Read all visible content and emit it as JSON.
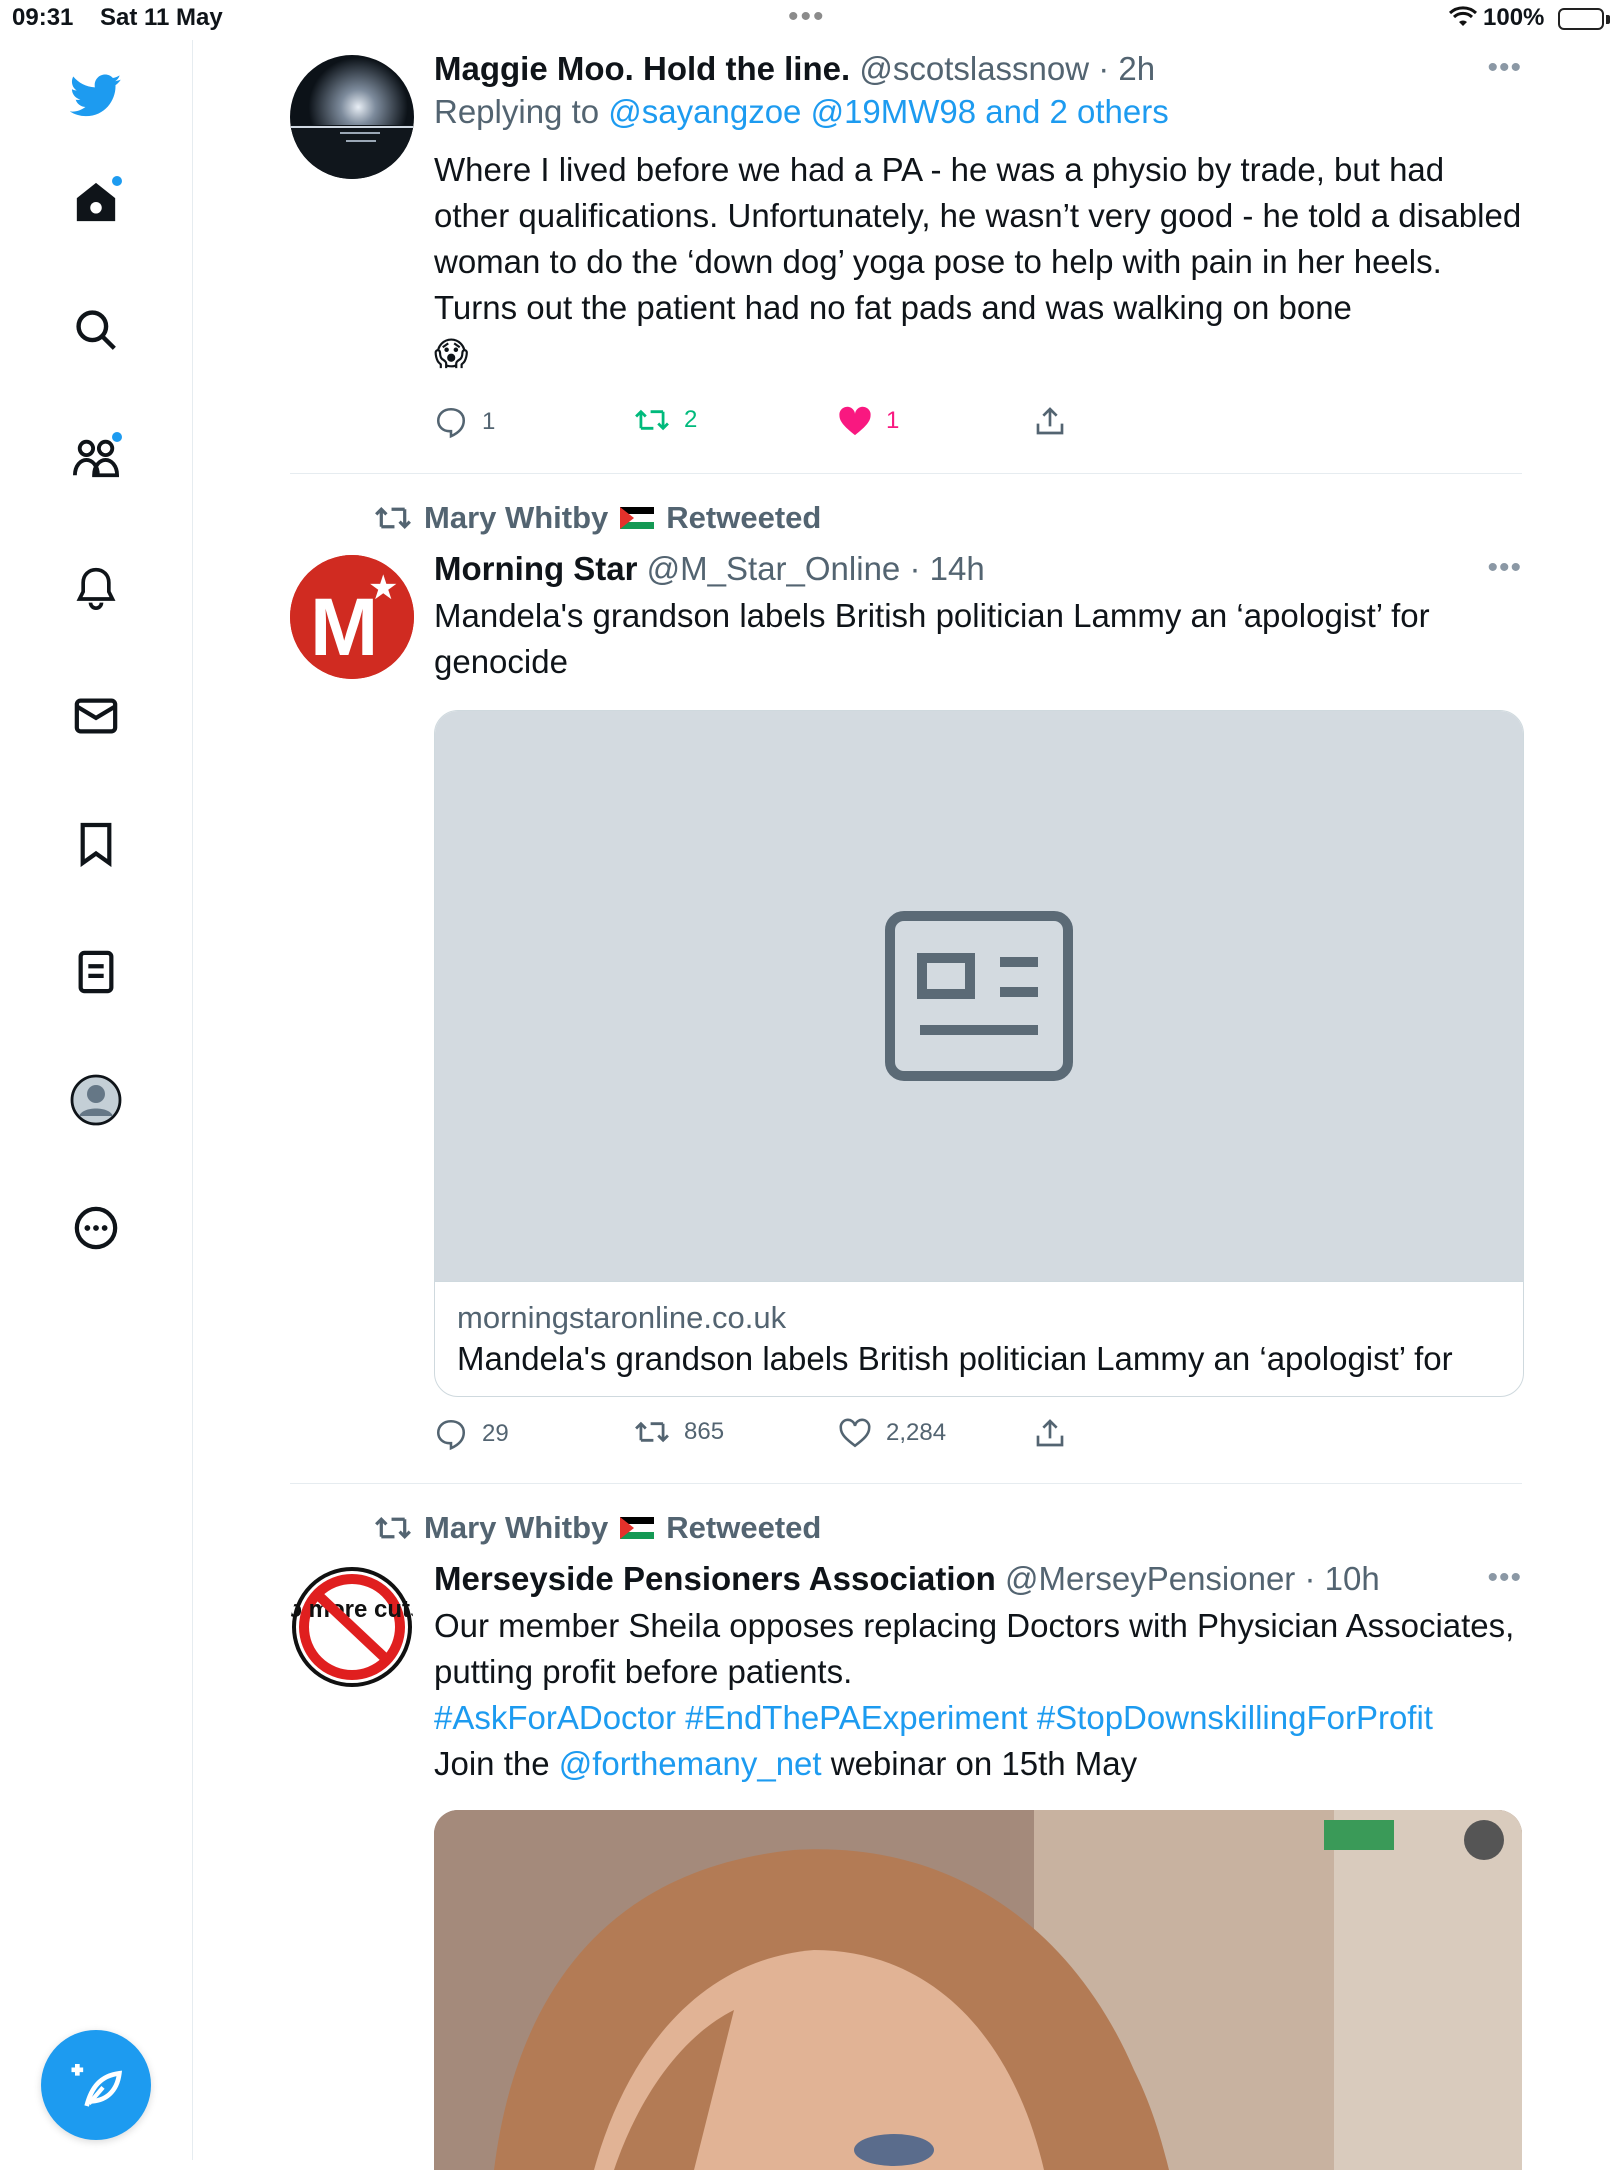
{
  "status_bar": {
    "time": "09:31",
    "date": "Sat 11 May",
    "battery": "100%"
  },
  "sidebar": {
    "items": [
      "twitter-logo",
      "home",
      "explore",
      "communities",
      "notifications",
      "messages",
      "bookmarks",
      "lists",
      "profile",
      "more"
    ]
  },
  "feed": {
    "tweets": [
      {
        "name": "Maggie Moo. Hold the line.",
        "handle": "@scotslassnow",
        "time": "2h",
        "replying_to_prefix": "Replying to",
        "replying_to_users": "@sayangzoe @19MW98 and 2 others",
        "text": "Where I lived before we had a PA - he was a physio by trade, but had other qualifications. Unfortunately, he wasn’t very good - he told a disabled woman to do the ‘down dog’ yoga pose to help with pain in her heels. Turns out the patient had no fat pads and was walking on bone",
        "emoji": "😱",
        "replies": "1",
        "retweets": "2",
        "likes": "1"
      },
      {
        "retweeted_by": "Mary Whitby",
        "retweeted_label": "Retweeted",
        "name": "Morning Star",
        "handle": "@M_Star_Online",
        "time": "14h",
        "text": "Mandela's grandson labels British politician Lammy an ‘apologist’ for genocide",
        "card_domain": "morningstaronline.co.uk",
        "card_title": "Mandela's grandson labels British politician Lammy an ‘apologist’ for",
        "replies": "29",
        "retweets": "865",
        "likes": "2,284"
      },
      {
        "retweeted_by": "Mary Whitby",
        "retweeted_label": "Retweeted",
        "name": "Merseyside Pensioners Association",
        "handle": "@MerseyPensioner",
        "time": "10h",
        "text_line1": "Our member Sheila opposes replacing Doctors with Physician Associates, putting profit before patients.",
        "hashtags": "#AskForADoctor #EndThePAExperiment #StopDownskillingForProfit",
        "join_prefix": "Join the",
        "join_mention": "@forthemany_net",
        "join_suffix": "webinar on 15th May",
        "avatar_text": "no more cuts!"
      }
    ]
  },
  "colors": {
    "accent": "#1d9bf0",
    "retweet_green": "#00ba7c",
    "like_pink": "#f91880"
  }
}
